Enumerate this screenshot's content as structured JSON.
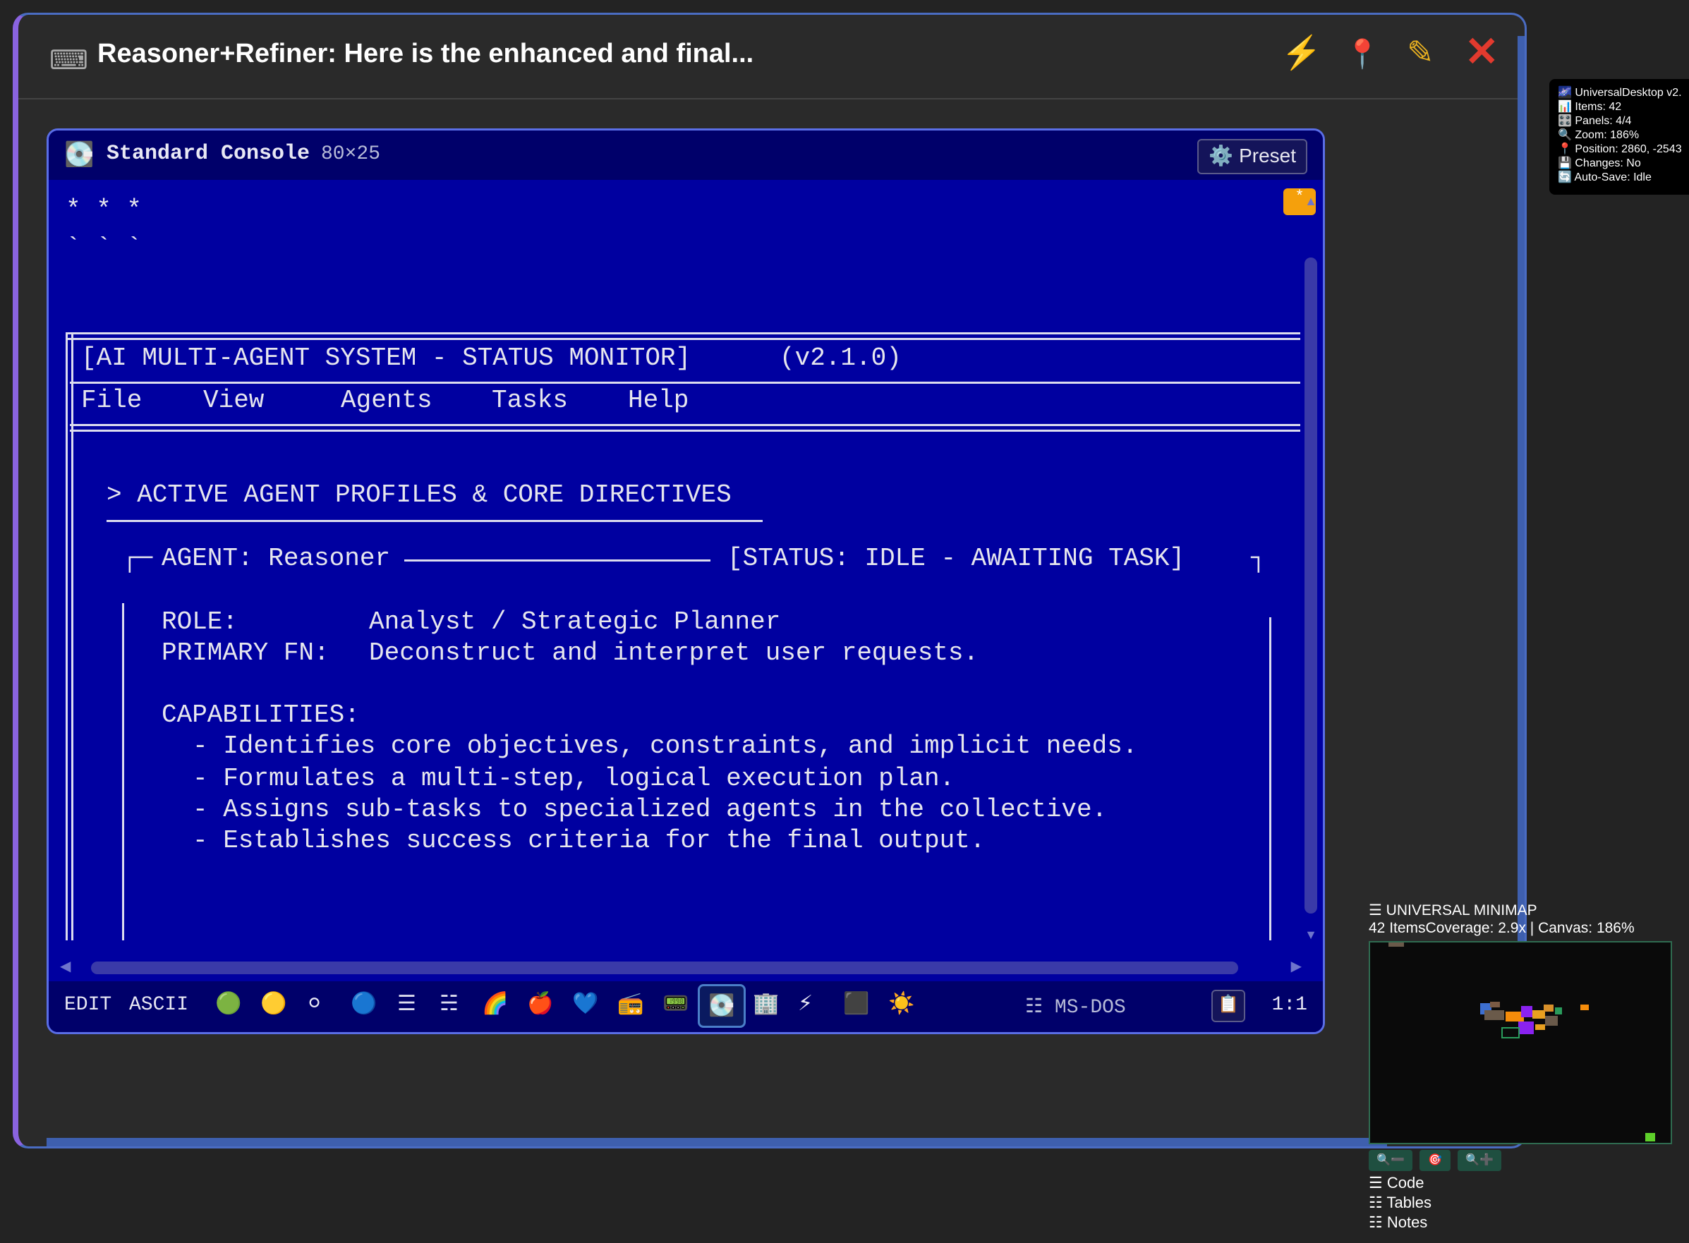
{
  "window": {
    "title_icon": "keyboard-icon",
    "title": "Reasoner+Refiner: Here is the enhanced and final...",
    "toolbar": [
      "bolt-icon",
      "pin-icon",
      "pencil-icon",
      "close-icon"
    ]
  },
  "console": {
    "icon": "disc-icon",
    "title": "Standard Console",
    "size": "80×25",
    "preset_label": "⚙️ Preset",
    "badge": "*",
    "lines": {
      "stars": "* * *",
      "ticks": "` ` `",
      "system_title": "[AI MULTI-AGENT SYSTEM - STATUS MONITOR]",
      "version": "(v2.1.0)",
      "menu": [
        "File",
        "View",
        "Agents",
        "Tasks",
        "Help"
      ],
      "section": "> ACTIVE AGENT PROFILES & CORE DIRECTIVES",
      "agent": "AGENT: Reasoner",
      "status": "[STATUS: IDLE - AWAITING TASK]",
      "role_label": "ROLE:",
      "role_value": "Analyst / Strategic Planner",
      "fn_label": "PRIMARY FN:",
      "fn_value": "Deconstruct and interpret user requests.",
      "capabilities": "CAPABILITIES:",
      "cap_items": [
        "- Identifies core objectives, constraints, and implicit needs.",
        "- Formulates a multi-step, logical execution plan.",
        "- Assigns sub-tasks to specialized agents in the collective.",
        "- Establishes success criteria for the final output."
      ]
    },
    "footer": {
      "edit": "EDIT",
      "ascii": "ASCII",
      "themes": [
        "🟢",
        "🟡",
        "⚪",
        "🔵",
        "☰",
        "☵",
        "🌈",
        "🍎",
        "💙",
        "📻",
        "📟",
        "💽",
        "🏢",
        "⚡",
        "⬛",
        "☀️"
      ],
      "selected_theme": 11,
      "mode": "☷ MS-DOS",
      "copy_icon": "📋",
      "ratio": "1:1"
    }
  },
  "status_panel": [
    "🌌 UniversalDesktop v2.",
    "📊 Items: 42",
    "🎛️ Panels: 4/4",
    "🔍 Zoom: 186%",
    "📍 Position: 2860, -2543",
    "💾 Changes: No",
    "🔄 Auto-Save: Idle"
  ],
  "minimap": {
    "title": "☰ UNIVERSAL MINIMAP",
    "subtitle": "42 ItemsCoverage: 2.9x | Canvas: 186%",
    "buttons": [
      "🔍➖",
      "🎯",
      "🔍➕"
    ],
    "menu": [
      "☰ Code",
      "☷ Tables",
      "☷ Notes"
    ]
  }
}
